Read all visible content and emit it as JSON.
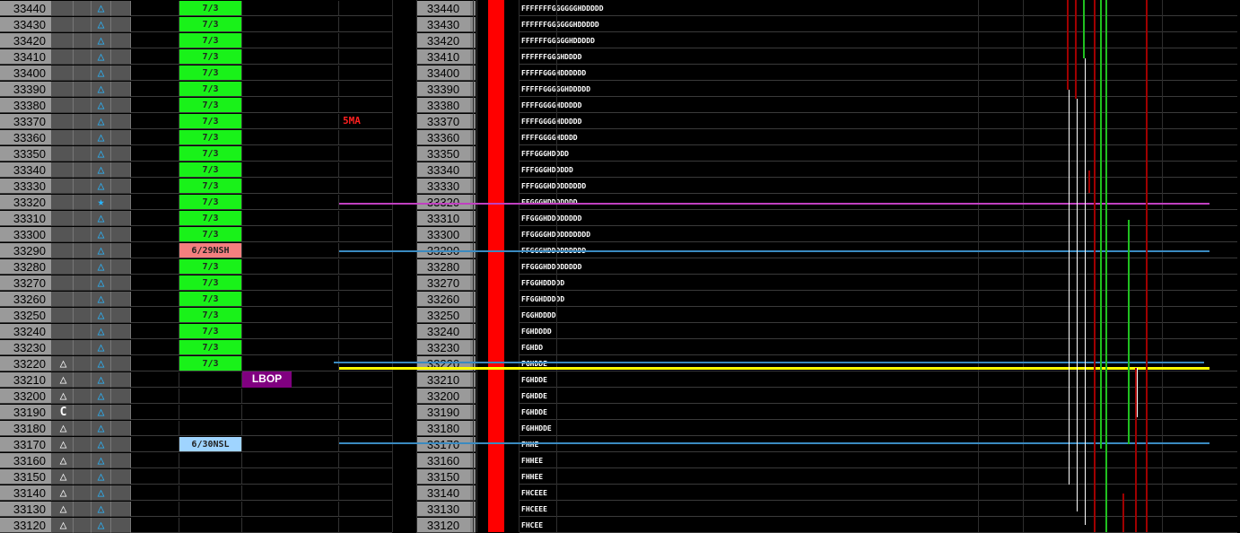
{
  "rows": [
    {
      "price": "33440",
      "a": "",
      "b": "△",
      "ib": "7/3",
      "profile": "FFFFFFFGGGGGGHDDDDD"
    },
    {
      "price": "33430",
      "a": "",
      "b": "△",
      "ib": "7/3",
      "profile": "FFFFFFGGGGGGHDDDDD"
    },
    {
      "price": "33420",
      "a": "",
      "b": "△",
      "ib": "7/3",
      "profile": "FFFFFFGGGGGHDDDDD"
    },
    {
      "price": "33410",
      "a": "",
      "b": "△",
      "ib": "7/3",
      "profile": "FFFFFFGGGHDDDD"
    },
    {
      "price": "33400",
      "a": "",
      "b": "△",
      "ib": "7/3",
      "profile": "FFFFFGGGHDDDDDD"
    },
    {
      "price": "33390",
      "a": "",
      "b": "△",
      "ib": "7/3",
      "profile": "FFFFFGGGGGHDDDDD"
    },
    {
      "price": "33380",
      "a": "",
      "b": "△",
      "ib": "7/3",
      "profile": "FFFFGGGGHDDDDD"
    },
    {
      "price": "33370",
      "a": "",
      "b": "△",
      "ib": "7/3",
      "profile": "FFFFGGGGHDDDDD"
    },
    {
      "price": "33360",
      "a": "",
      "b": "△",
      "ib": "7/3",
      "profile": "FFFFGGGGHDDDD"
    },
    {
      "price": "33350",
      "a": "",
      "b": "△",
      "ib": "7/3",
      "profile": "FFFGGGHDDDD"
    },
    {
      "price": "33340",
      "a": "",
      "b": "△",
      "ib": "7/3",
      "profile": "FFFGGGHDDDDD"
    },
    {
      "price": "33330",
      "a": "",
      "b": "△",
      "ib": "7/3",
      "profile": "FFFGGGHDDDDDDDD"
    },
    {
      "price": "33320",
      "a": "",
      "b": "★",
      "ib": "7/3",
      "profile": "FFGGGHDDDDDDD"
    },
    {
      "price": "33310",
      "a": "",
      "b": "△",
      "ib": "7/3",
      "profile": "FFGGGHDDDDDDDD"
    },
    {
      "price": "33300",
      "a": "",
      "b": "△",
      "ib": "7/3",
      "profile": "FFGGGGHDDDDDDDDD"
    },
    {
      "price": "33290",
      "a": "",
      "b": "△",
      "ib": "6/29NSH",
      "profile": "FFGGGHDDDDDDDDD"
    },
    {
      "price": "33280",
      "a": "",
      "b": "△",
      "ib": "7/3",
      "profile": "FFGGGHDDDDDDDD"
    },
    {
      "price": "33270",
      "a": "",
      "b": "△",
      "ib": "7/3",
      "profile": "FFGGHDDDDD"
    },
    {
      "price": "33260",
      "a": "",
      "b": "△",
      "ib": "7/3",
      "profile": "FFGGHDDDDD"
    },
    {
      "price": "33250",
      "a": "",
      "b": "△",
      "ib": "7/3",
      "profile": "FGGHDDDD"
    },
    {
      "price": "33240",
      "a": "",
      "b": "△",
      "ib": "7/3",
      "profile": "FGHDDDD"
    },
    {
      "price": "33230",
      "a": "",
      "b": "△",
      "ib": "7/3",
      "profile": "FGHDD"
    },
    {
      "price": "33220",
      "a": "△",
      "b": "△",
      "ib": "7/3",
      "profile": "FGHDDE"
    },
    {
      "price": "33210",
      "a": "△",
      "b": "△",
      "ib": "",
      "profile": "FGHDDE"
    },
    {
      "price": "33200",
      "a": "△",
      "b": "△",
      "ib": "",
      "profile": "FGHDDE"
    },
    {
      "price": "33190",
      "a": "C",
      "b": "△",
      "ib": "",
      "profile": "FGHDDE"
    },
    {
      "price": "33180",
      "a": "△",
      "b": "△",
      "ib": "",
      "profile": "FGHHDDE"
    },
    {
      "price": "33170",
      "a": "△",
      "b": "△",
      "ib": "6/30NSL",
      "profile": "FHHE"
    },
    {
      "price": "33160",
      "a": "△",
      "b": "△",
      "ib": "",
      "profile": "FHHEE"
    },
    {
      "price": "33150",
      "a": "△",
      "b": "△",
      "ib": "",
      "profile": "FHHEE"
    },
    {
      "price": "33140",
      "a": "△",
      "b": "△",
      "ib": "",
      "profile": "FHCEEE"
    },
    {
      "price": "33130",
      "a": "△",
      "b": "△",
      "ib": "",
      "profile": "FHCEEE"
    },
    {
      "price": "33120",
      "a": "△",
      "b": "△",
      "ib": "",
      "profile": "FHCEE"
    }
  ],
  "labels": {
    "lbop": "LBOP",
    "ma5": "5MA"
  },
  "colors": {
    "ib_green": "#19f219",
    "nsh": "#f47f7f",
    "nsl": "#9fd4ff",
    "triangle_blue": "#29b6ff",
    "lbop_bg": "#800080",
    "ma5_text": "#ff2020",
    "red_bar": "#ff0000"
  },
  "icons": {
    "triangle": "triangle-icon",
    "star": "star-icon"
  }
}
